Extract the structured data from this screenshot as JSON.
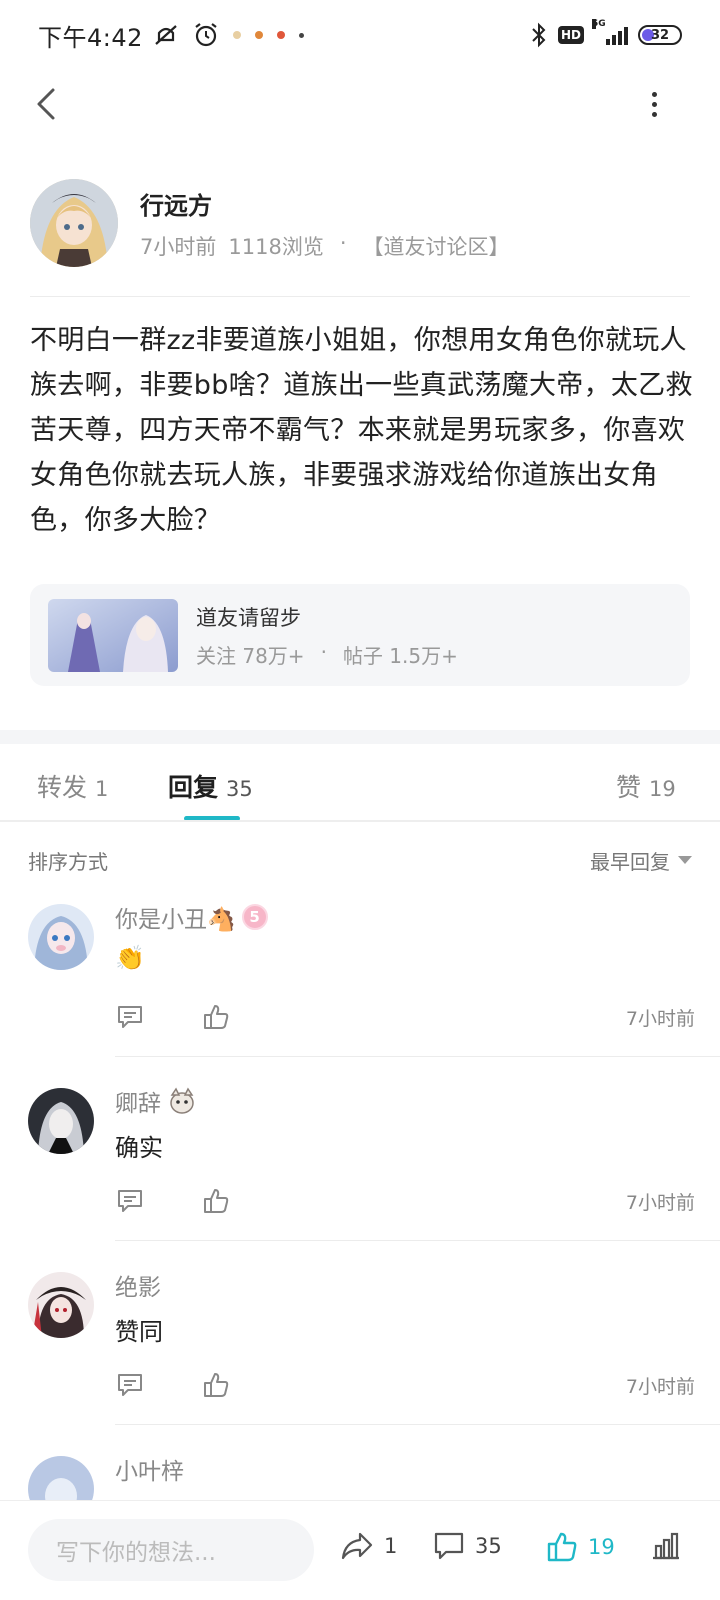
{
  "status_bar": {
    "time": "下午4:42",
    "network": "5G",
    "hd": "HD",
    "battery": "32",
    "battery_level": 0.32
  },
  "nav": {
    "back_icon": "chevron-left-icon",
    "more_icon": "more-vertical-icon"
  },
  "post": {
    "author": "行远方",
    "time_ago": "7小时前",
    "views": "1118浏览",
    "separator": "·",
    "forum_tag": "【道友讨论区】",
    "body": "不明白一群zz非要道族小姐姐，你想用女角色你就玩人族去啊，非要bb啥？道族出一些真武荡魔大帝，太乙救苦天尊，四方天帝不霸气？本来就是男玩家多，你喜欢女角色你就去玩人族，非要强求游戏给你道族出女角色，你多大脸？"
  },
  "forum_card": {
    "name": "道友请留步",
    "follows": "关注 78万+",
    "separator": "·",
    "posts": "帖子 1.5万+"
  },
  "tabs": [
    {
      "label": "转发",
      "count": "1"
    },
    {
      "label": "回复",
      "count": "35"
    },
    {
      "label": "赞",
      "count": "19"
    }
  ],
  "sort": {
    "label": "排序方式",
    "selected": "最早回复"
  },
  "comments": [
    {
      "name": "你是小丑🐴",
      "badge": "5",
      "text": "👏",
      "time": "7小时前"
    },
    {
      "name": "卿辞",
      "text": "确实",
      "time": "7小时前"
    },
    {
      "name": "绝影",
      "text": "赞同",
      "time": "7小时前"
    },
    {
      "name": "小叶梓"
    }
  ],
  "bottom_bar": {
    "placeholder": "写下你的想法...",
    "share_count": "1",
    "comment_count": "35",
    "like_count": "19"
  },
  "colors": {
    "accent": "#1fb8c7",
    "text": "#222222",
    "muted": "#888888"
  }
}
